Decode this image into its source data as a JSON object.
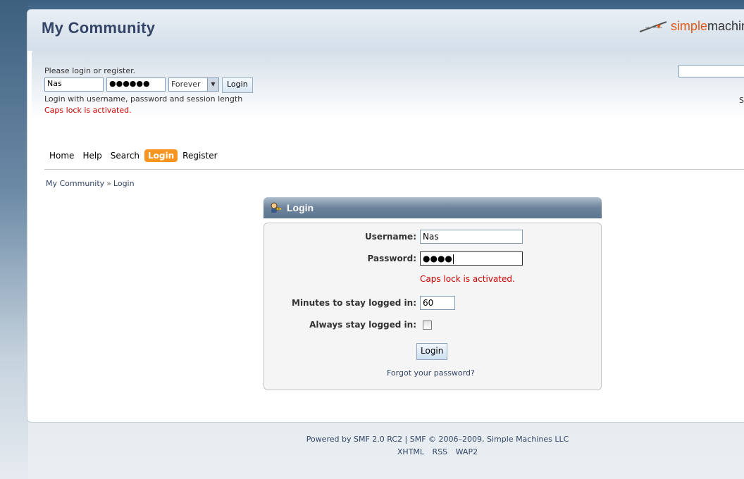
{
  "header": {
    "forum_title": "My Community",
    "logo_part1": "simple",
    "logo_part2": "machines"
  },
  "userbox": {
    "prompt": "Please login or register.",
    "username_value": "Nas",
    "password_value": "●●●●●●",
    "session_length_selected": "Forever",
    "login_button": "Login",
    "hint": "Login with username, password and session length",
    "caps_warning": "Caps lock is activated.",
    "search_partial": "S"
  },
  "menu": {
    "items": [
      {
        "label": "Home",
        "active": false
      },
      {
        "label": "Help",
        "active": false
      },
      {
        "label": "Search",
        "active": false
      },
      {
        "label": "Login",
        "active": true
      },
      {
        "label": "Register",
        "active": false
      }
    ]
  },
  "breadcrumb": {
    "items": [
      "My Community",
      "Login"
    ],
    "separator": "»"
  },
  "login_panel": {
    "title": "Login",
    "username_label": "Username:",
    "username_value": "Nas",
    "password_label": "Password:",
    "password_value": "●●●●",
    "caps_warning": "Caps lock is activated.",
    "minutes_label": "Minutes to stay logged in:",
    "minutes_value": "60",
    "always_label": "Always stay logged in:",
    "always_checked": false,
    "login_button": "Login",
    "forgot_link": "Forgot your password?"
  },
  "footer": {
    "powered": "Powered by SMF 2.0 RC2 | SMF © 2006–2009, Simple Machines LLC",
    "links": [
      "XHTML",
      "RSS",
      "WAP2"
    ]
  },
  "colors": {
    "accent": "#f7941d",
    "link": "#334466",
    "error": "#cc0000",
    "logo_orange": "#e05a1a"
  }
}
